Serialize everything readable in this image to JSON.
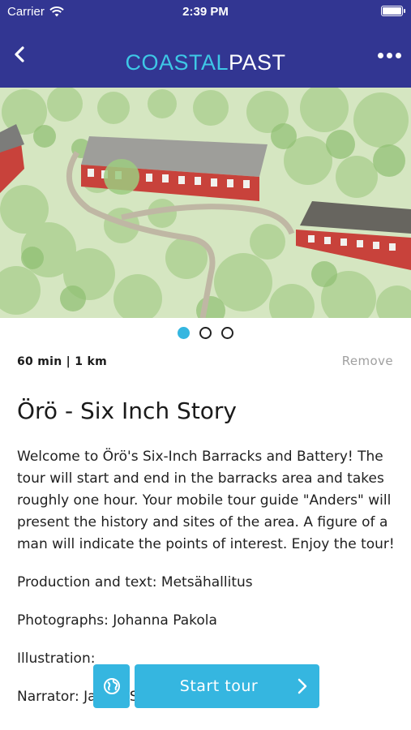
{
  "status_bar": {
    "carrier": "Carrier",
    "time": "2:39 PM"
  },
  "nav": {
    "brand_part1": "COASTAL",
    "brand_part2": "PAST",
    "back_icon": "chevron-left-icon",
    "more_icon": "more-dots-icon"
  },
  "colors": {
    "nav_bg": "#323692",
    "accent": "#35b6e0",
    "brand_cyan": "#3ec8e6"
  },
  "carousel": {
    "image_description_icon": "illustration-barracks",
    "page_count": 3,
    "active_index": 0
  },
  "tour": {
    "meta": "60 min | 1 km",
    "remove_label": "Remove",
    "title": "Örö - Six Inch Story",
    "description": "Welcome to Örö's Six-Inch Barracks and Battery! The tour will start and end in the barracks area and takes roughly one hour. Your mobile tour guide \"Anders\" will present the history and sites of the area. A figure of a man will indicate the points of interest. Enjoy the tour!",
    "production": "Production and text: Metsähallitus",
    "photographs": "Photographs: Johanna Pakola",
    "illustration": "Illustration: ",
    "narrator": "Narrator: James Simpson"
  },
  "actions": {
    "start_label": "Start tour",
    "globe_icon": "globe-icon",
    "chevron_icon": "chevron-right-icon"
  }
}
